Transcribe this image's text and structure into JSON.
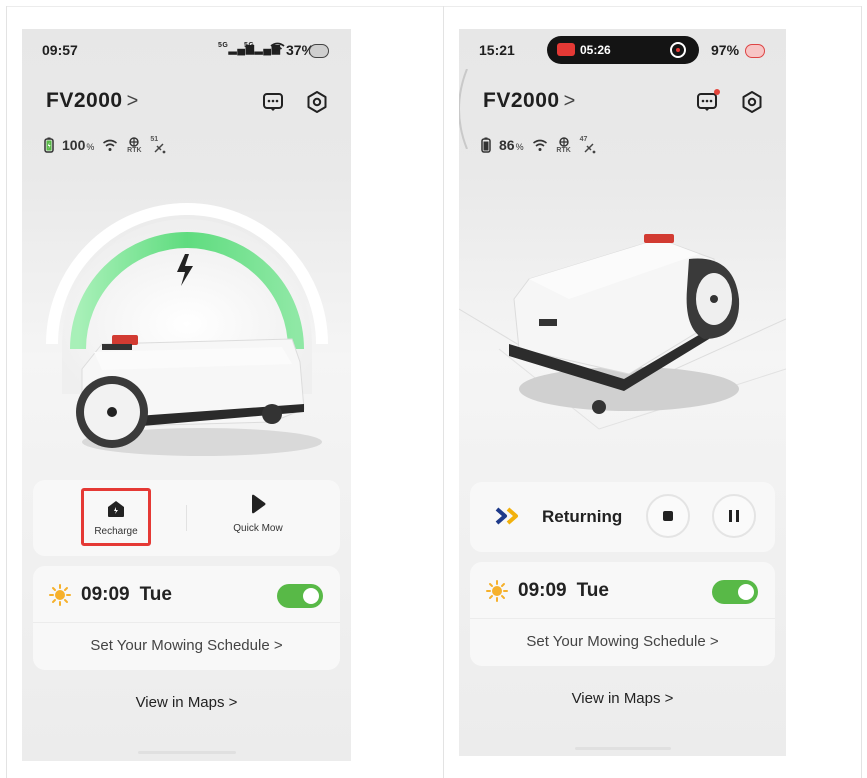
{
  "left": {
    "status": {
      "time": "09:57",
      "signal1": "5G",
      "signal2": "5G",
      "battery_pct": "37%"
    },
    "device_title": "FV2000",
    "title_chevron": ">",
    "info": {
      "battery": "100",
      "battery_unit": "%",
      "rtk": "RTK",
      "sat_count": "51"
    },
    "actions": {
      "recharge_label": "Recharge",
      "quick_mow_label": "Quick Mow"
    },
    "schedule": {
      "time": "09:09",
      "day": "Tue",
      "toggle_on": true,
      "link": "Set Your Mowing Schedule",
      "link_chevron": ">"
    },
    "maps_link": "View in Maps",
    "maps_chevron": ">"
  },
  "right": {
    "status": {
      "time": "15:21",
      "recording_time": "05:26",
      "battery_pct": "97%"
    },
    "device_title": "FV2000",
    "title_chevron": ">",
    "info": {
      "battery": "86",
      "battery_unit": "%",
      "rtk": "RTK",
      "sat_count": "47"
    },
    "returning": {
      "label": "Returning"
    },
    "schedule": {
      "time": "09:09",
      "day": "Tue",
      "toggle_on": true,
      "link": "Set Your Mowing Schedule",
      "link_chevron": ">"
    },
    "maps_link": "View in Maps",
    "maps_chevron": ">"
  },
  "colors": {
    "accent_green": "#58b947",
    "charge_arc": "#6fe28a",
    "highlight_red": "#e53935",
    "return_blue": "#1e3a8a",
    "return_yellow": "#f2b10d"
  }
}
